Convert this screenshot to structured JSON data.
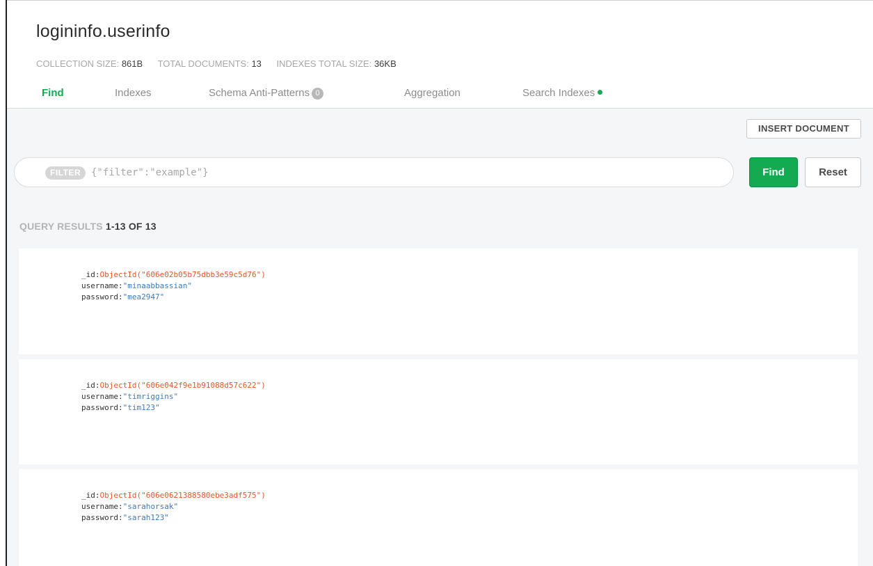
{
  "collection": {
    "title": "logininfo.userinfo",
    "stats": [
      {
        "label": "COLLECTION SIZE:",
        "value": "861B"
      },
      {
        "label": "TOTAL DOCUMENTS:",
        "value": "13"
      },
      {
        "label": "INDEXES TOTAL SIZE:",
        "value": "36KB"
      }
    ]
  },
  "tabs": [
    {
      "label": "Find",
      "active": true
    },
    {
      "label": "Indexes",
      "active": false
    },
    {
      "label": "Schema Anti-Patterns",
      "badge": "0",
      "active": false
    },
    {
      "label": "Aggregation",
      "active": false
    },
    {
      "label": "Search Indexes",
      "status_dot": "green",
      "active": false
    }
  ],
  "toolbar": {
    "insert_label": "INSERT DOCUMENT"
  },
  "query": {
    "filter_tag": "FILTER",
    "filter_value": "",
    "filter_placeholder": "{\"filter\":\"example\"}",
    "find_label": "Find",
    "reset_label": "Reset"
  },
  "results": {
    "label": "QUERY RESULTS",
    "count": "1-13 OF 13",
    "documents": [
      {
        "fields": [
          {
            "key": "_id:",
            "value": "ObjectId(\"606e02b05b75dbb3e59c5d76\")",
            "type": "oid"
          },
          {
            "key": "username:",
            "value": "\"minaabbassian\"",
            "type": "str"
          },
          {
            "key": "password:",
            "value": "\"mea2947\"",
            "type": "str"
          }
        ]
      },
      {
        "fields": [
          {
            "key": "_id:",
            "value": "ObjectId(\"606e042f9e1b91088d57c622\")",
            "type": "oid"
          },
          {
            "key": "username:",
            "value": "\"timriggins\"",
            "type": "str"
          },
          {
            "key": "password:",
            "value": "\"tim123\"",
            "type": "str"
          }
        ]
      },
      {
        "fields": [
          {
            "key": "_id:",
            "value": "ObjectId(\"606e0621388580ebe3adf575\")",
            "type": "oid"
          },
          {
            "key": "username:",
            "value": "\"sarahorsak\"",
            "type": "str"
          },
          {
            "key": "password:",
            "value": "\"sarah123\"",
            "type": "str"
          }
        ]
      }
    ]
  },
  "colors": {
    "accent_green": "#13aa52",
    "objectid_orange": "#e8552b",
    "string_blue": "#3d7ab8"
  }
}
